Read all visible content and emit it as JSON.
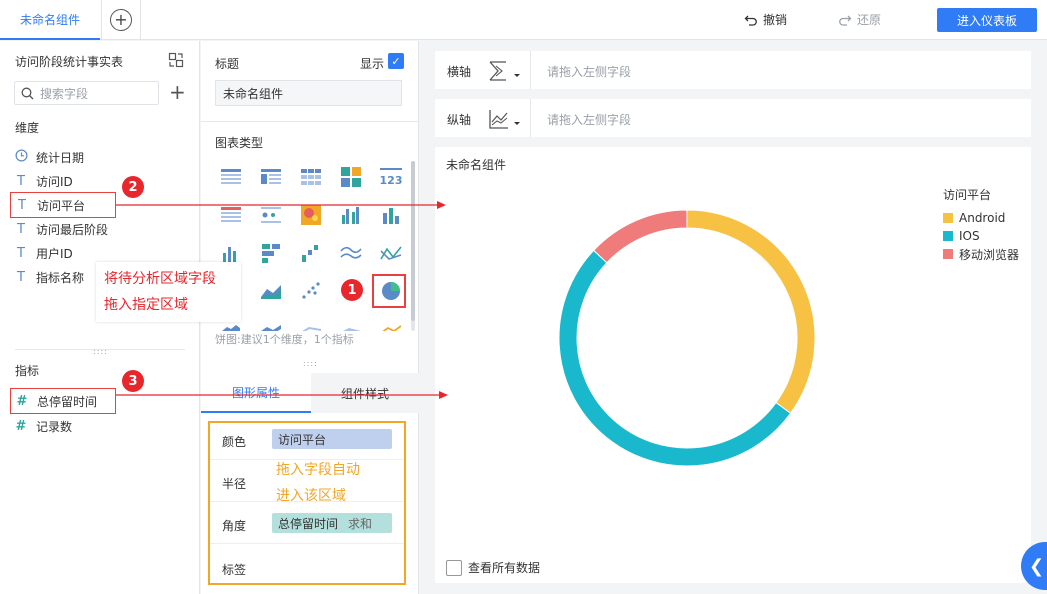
{
  "topbar": {
    "active_tab": "未命名组件",
    "undo_label": "撤销",
    "redo_label": "还原",
    "enter_dashboard_label": "进入仪表板"
  },
  "left": {
    "dataset_title": "访问阶段统计事实表",
    "search_placeholder": "搜索字段",
    "dimension_label": "维度",
    "dimensions": [
      "统计日期",
      "访问ID",
      "访问平台",
      "访问最后阶段",
      "用户ID",
      "指标名称"
    ],
    "measure_label": "指标",
    "measures": [
      "总停留时间",
      "记录数"
    ]
  },
  "middle": {
    "title_label": "标题",
    "show_label": "显示",
    "title_value": "未命名组件",
    "chart_type_label": "图表类型",
    "pie_hint": "饼图:建议1个维度，1个指标",
    "tab_graph_props": "图形属性",
    "tab_component_style": "组件样式",
    "props": {
      "color_label": "颜色",
      "color_field": "访问平台",
      "radius_label": "半径",
      "angle_label": "角度",
      "angle_field": "总停留时间",
      "angle_agg": "求和",
      "label_label": "标签"
    }
  },
  "axes": {
    "x_label": "横轴",
    "y_label": "纵轴",
    "placeholder": "请拖入左侧字段"
  },
  "canvas": {
    "title": "未命名组件",
    "view_all_label": "查看所有数据"
  },
  "chart_data": {
    "type": "pie",
    "variant": "donut",
    "legend_title": "访问平台",
    "legend_position": "top-right",
    "categories": [
      "Android",
      "IOS",
      "移动浏览器"
    ],
    "values": [
      35,
      52,
      13
    ],
    "colors": [
      "#f7c244",
      "#19b8cc",
      "#f07b7b"
    ]
  },
  "annotations": {
    "badge1": "1",
    "badge2": "2",
    "badge3": "3",
    "callout_line1": "将待分析区域字段",
    "callout_line2": "拖入指定区域",
    "orange_line1": "拖入字段自动",
    "orange_line2": "进入该区域"
  }
}
